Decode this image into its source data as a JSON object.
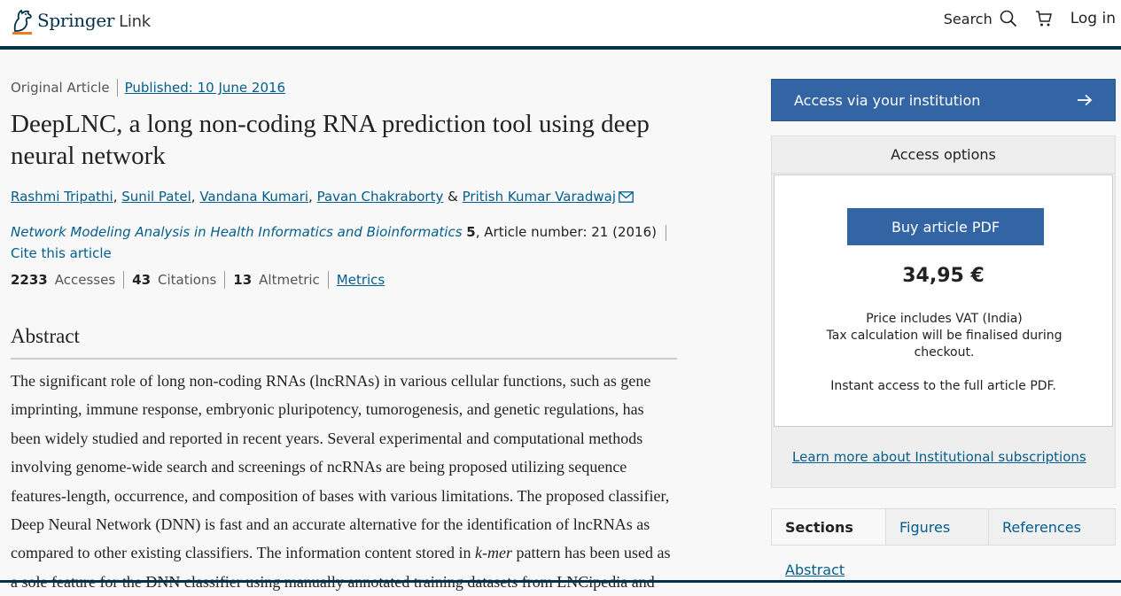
{
  "header": {
    "brand": "Springer",
    "brand_suffix": "Link",
    "search_label": "Search",
    "login_label": "Log in"
  },
  "article": {
    "type": "Original Article",
    "published": "Published: 10 June 2016",
    "title": "DeepLNC, a long non-coding RNA prediction tool using deep neural network",
    "authors": [
      "Rashmi Tripathi",
      "Sunil Patel",
      "Vandana Kumari",
      "Pavan Chakraborty",
      "Pritish Kumar Varadwaj"
    ],
    "author_sep": ",",
    "author_amp": "&",
    "journal_name": "Network Modeling Analysis in Health Informatics and Bioinformatics",
    "volume": "5",
    "article_number": ", Article number: 21 (2016)",
    "cite_label": "Cite this article",
    "metrics": {
      "accesses_count": "2233",
      "accesses_label": "Accesses",
      "citations_count": "43",
      "citations_label": "Citations",
      "altmetric_count": "13",
      "altmetric_label": "Altmetric",
      "metrics_link": "Metrics"
    },
    "abstract_heading": "Abstract",
    "abstract_p1": "The significant role of long non-coding RNAs (lncRNAs) in various cellular functions, such as gene imprinting, immune response, embryonic pluripotency, tumorogenesis, and genetic regulations, has been widely studied and reported in recent years. Several experimental and computational methods involving genome-wide search and screenings of ncRNAs are being proposed utilizing sequence features-length, occurrence, and composition of bases with various limitations. The proposed classifier, Deep Neural Network (DNN) is fast and an accurate alternative for the identification of lncRNAs as compared to other existing classifiers. The information content stored in ",
    "abstract_kmer": "k-mer",
    "abstract_p2": " pattern has been used as a sole feature for the DNN classifier using manually annotated training datasets from LNCipedia and"
  },
  "sidebar": {
    "institution_button": "Access via your institution",
    "access_options": "Access options",
    "buy_button": "Buy article PDF",
    "price": "34,95 €",
    "vat_line1": "Price includes VAT (India)",
    "vat_line2": "Tax calculation will be finalised during checkout.",
    "instant": "Instant access to the full article PDF.",
    "learn_more": "Learn more about Institutional subscriptions",
    "tabs": [
      "Sections",
      "Figures",
      "References"
    ],
    "toc_first": "Abstract"
  },
  "colors": {
    "brand_navy": "#01324b",
    "button_blue": "#3365a4",
    "link_blue": "#025e8d",
    "logo_orange": "#f0781e"
  }
}
